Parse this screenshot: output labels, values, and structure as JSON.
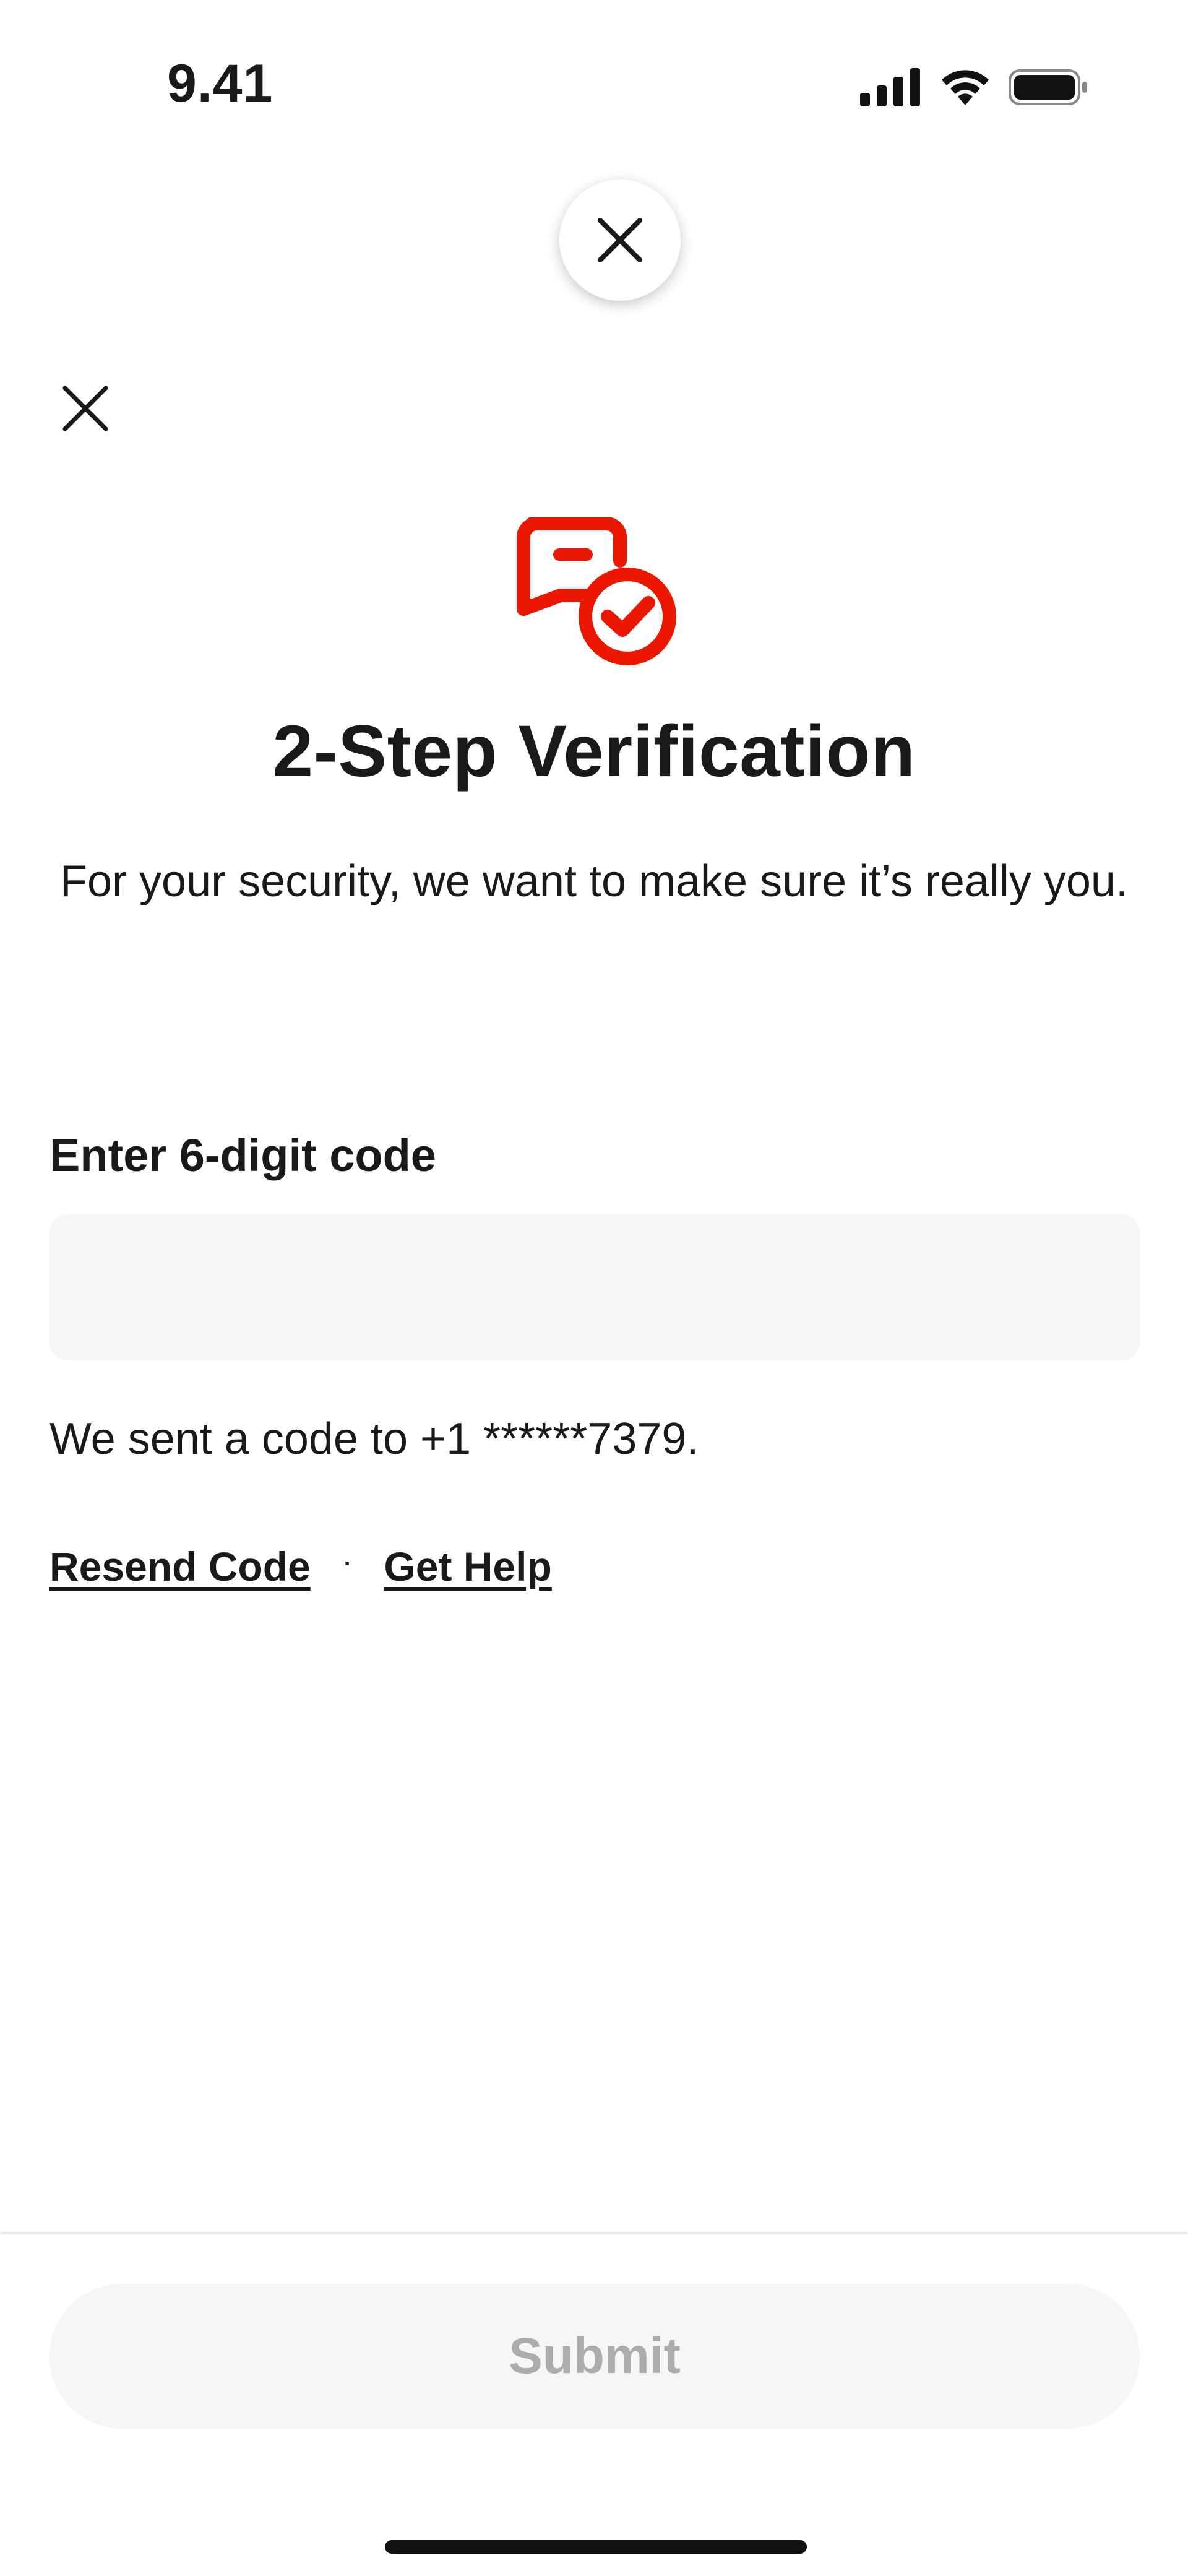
{
  "status_bar": {
    "time": "9.41",
    "signal_icon": "cellular-signal-icon",
    "wifi_icon": "wifi-icon",
    "battery_icon": "battery-icon"
  },
  "float_close": {
    "icon": "close-icon"
  },
  "modal": {
    "close_icon": "close-icon",
    "hero_icon": "chat-bubble-check-icon",
    "title": "2-Step Verification",
    "subtitle": "For your security, we want to make sure it’s really you.",
    "code_field": {
      "label": "Enter 6-digit code",
      "value": "",
      "placeholder": ""
    },
    "sent_message": "We sent a code to +1 ******7379.",
    "resend_label": "Resend Code",
    "separator": "·",
    "help_label": "Get Help"
  },
  "footer": {
    "submit_label": "Submit"
  },
  "colors": {
    "accent": "#EB1700",
    "text": "#191919",
    "input_bg": "#F6F6F6",
    "disabled_text": "#ACACAC"
  }
}
